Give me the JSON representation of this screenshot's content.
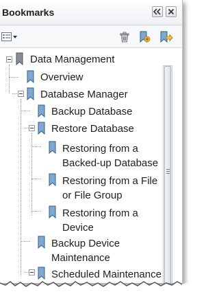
{
  "panel": {
    "title": "Bookmarks"
  },
  "toolbar": {
    "options_icon": "options-menu-icon",
    "delete_icon": "trash-icon",
    "new_bookmark_icon": "new-bookmark-icon",
    "bookmark_action_icon": "bookmark-action-icon"
  },
  "tree": {
    "items": [
      {
        "label": "Data Management",
        "level": 0,
        "expanded": true
      },
      {
        "label": "Overview",
        "level": 1
      },
      {
        "label": "Database Manager",
        "level": 1,
        "expanded": true
      },
      {
        "label": "Backup Database",
        "level": 2
      },
      {
        "label": "Restore Database",
        "level": 2,
        "expanded": true
      },
      {
        "label": "Restoring from a",
        "label2": "Backed-up Database",
        "level": 3
      },
      {
        "label": "Restoring from a File",
        "label2": "or File Group",
        "level": 3
      },
      {
        "label": "Restoring from a",
        "label2": "Device",
        "level": 3
      },
      {
        "label": "Backup Device",
        "label2": "Maintenance",
        "level": 2
      },
      {
        "label": "Scheduled Maintenance",
        "level": 2,
        "expanded": true
      }
    ]
  },
  "colors": {
    "bookmark_fill": "#7fa7cf",
    "bookmark_stroke": "#2f5f8f",
    "root_bookmark_fill": "#8a8f96"
  }
}
